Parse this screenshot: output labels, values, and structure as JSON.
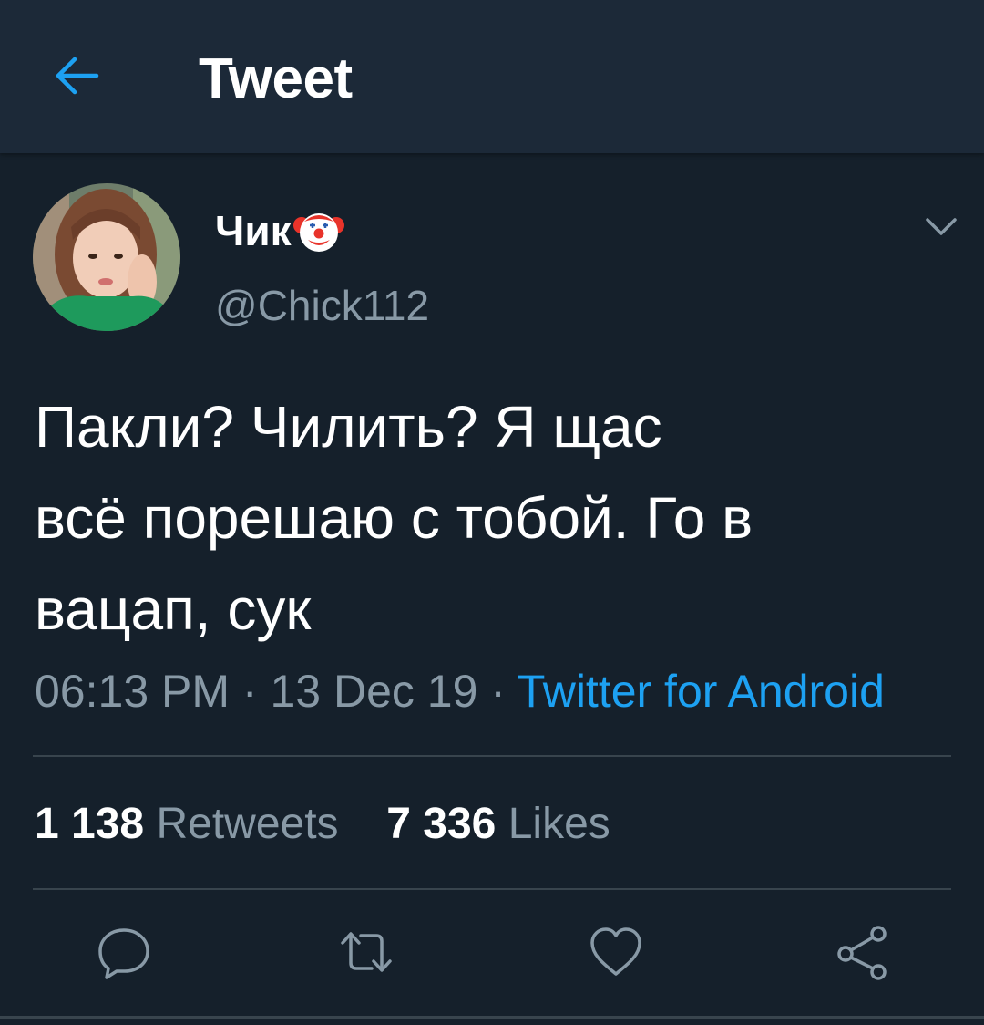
{
  "header": {
    "title": "Tweet",
    "back_icon": "arrow-left-icon",
    "accent_color": "#1da1f2"
  },
  "tweet": {
    "display_name": "Чик",
    "name_emoji_icon": "clown-face-icon",
    "handle": "@Chick112",
    "text": "Пакли? Чилить? Я щас\nвсё порешаю с тобой. Го в\nвацап, сук",
    "time": "06:13 PM",
    "date": "13 Dec 19",
    "separator": " · ",
    "source": "Twitter for Android"
  },
  "stats": {
    "retweets_count": "1 138",
    "retweets_label": "Retweets",
    "likes_count": "7 336",
    "likes_label": "Likes"
  },
  "actions": [
    "reply-icon",
    "retweet-icon",
    "like-icon",
    "share-icon"
  ],
  "colors": {
    "background": "#15202b",
    "header_background": "#1c2938",
    "secondary_text": "#8899a6",
    "divider": "#38444d",
    "link": "#1da1f2"
  }
}
